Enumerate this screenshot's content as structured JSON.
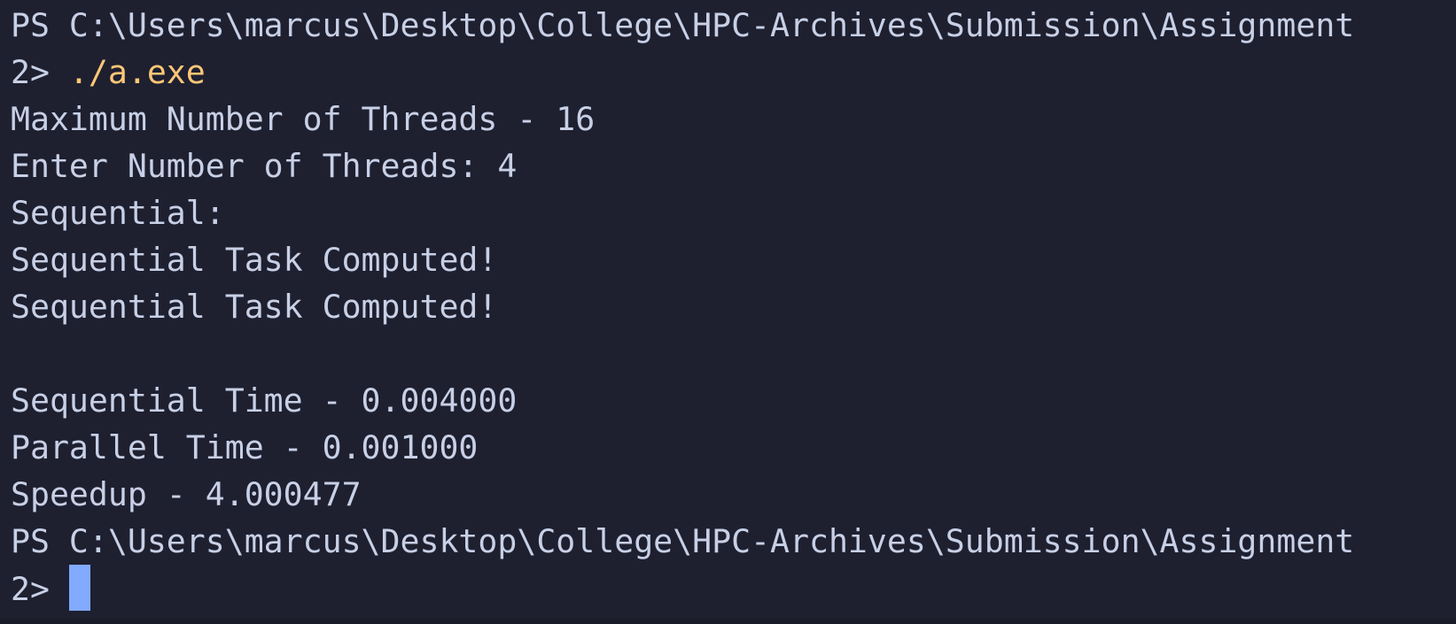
{
  "terminal": {
    "colors": {
      "background": "#1e2030",
      "text": "#c8d0e6",
      "command": "#ffc777",
      "cursor": "#82aaff"
    },
    "prompt1": {
      "path": "PS C:\\Users\\marcus\\Desktop\\College\\HPC-Archives\\Submission\\Assignment",
      "suffix": "2> ",
      "command": "./a.exe"
    },
    "output": [
      "Maximum Number of Threads - 16",
      "Enter Number of Threads: 4",
      "Sequential:",
      "Sequential Task Computed!",
      "Sequential Task Computed!",
      "",
      "Sequential Time - 0.004000",
      "Parallel Time - 0.001000",
      "Speedup - 4.000477"
    ],
    "prompt2": {
      "path": "PS C:\\Users\\marcus\\Desktop\\College\\HPC-Archives\\Submission\\Assignment",
      "suffix": "2>"
    }
  }
}
